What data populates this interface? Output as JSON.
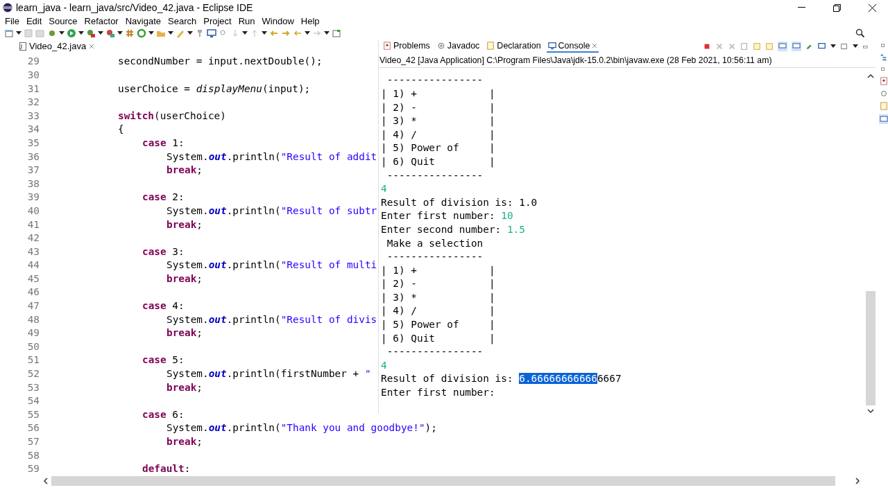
{
  "window": {
    "title": "learn_java - learn_java/src/Video_42.java - Eclipse IDE"
  },
  "menu": [
    "File",
    "Edit",
    "Source",
    "Refactor",
    "Navigate",
    "Search",
    "Project",
    "Run",
    "Window",
    "Help"
  ],
  "editor": {
    "tab": {
      "label": "Video_42.java",
      "selected": true
    },
    "lines": [
      {
        "number": "29",
        "kind": "block",
        "tokens": [
          {
            "text": "secondNumber = input.nextDouble();",
            "kind": "plain"
          }
        ]
      },
      {
        "number": "30",
        "kind": "blank"
      },
      {
        "number": "31",
        "kind": "block",
        "tokens": [
          {
            "text": "userChoice = ",
            "kind": "plain"
          },
          {
            "text": "displayMenu",
            "kind": "method"
          },
          {
            "text": "(input);",
            "kind": "plain"
          }
        ]
      },
      {
        "number": "32",
        "kind": "blank"
      },
      {
        "number": "33",
        "kind": "block",
        "tokens": [
          {
            "text": "switch",
            "kind": "keyword"
          },
          {
            "text": "(userChoice)",
            "kind": "plain"
          }
        ]
      },
      {
        "number": "34",
        "kind": "block",
        "tokens": [
          {
            "text": "{",
            "kind": "plain"
          }
        ]
      },
      {
        "number": "35",
        "kind": "case",
        "tokens": [
          {
            "text": "case",
            "kind": "keyword"
          },
          {
            "text": " 1:",
            "kind": "plain"
          }
        ]
      },
      {
        "number": "36",
        "kind": "body",
        "tokens": [
          {
            "text": "System.",
            "kind": "plain"
          },
          {
            "text": "out",
            "kind": "field"
          },
          {
            "text": ".println(",
            "kind": "plain"
          },
          {
            "text": "\"Result of addit",
            "kind": "string"
          }
        ]
      },
      {
        "number": "37",
        "kind": "body",
        "tokens": [
          {
            "text": "break",
            "kind": "keyword"
          },
          {
            "text": ";",
            "kind": "plain"
          }
        ]
      },
      {
        "number": "38",
        "kind": "blank"
      },
      {
        "number": "39",
        "kind": "case",
        "tokens": [
          {
            "text": "case",
            "kind": "keyword"
          },
          {
            "text": " 2:",
            "kind": "plain"
          }
        ]
      },
      {
        "number": "40",
        "kind": "body",
        "tokens": [
          {
            "text": "System.",
            "kind": "plain"
          },
          {
            "text": "out",
            "kind": "field"
          },
          {
            "text": ".println(",
            "kind": "plain"
          },
          {
            "text": "\"Result of subtr",
            "kind": "string"
          }
        ]
      },
      {
        "number": "41",
        "kind": "body",
        "tokens": [
          {
            "text": "break",
            "kind": "keyword"
          },
          {
            "text": ";",
            "kind": "plain"
          }
        ]
      },
      {
        "number": "42",
        "kind": "blank"
      },
      {
        "number": "43",
        "kind": "case",
        "tokens": [
          {
            "text": "case",
            "kind": "keyword"
          },
          {
            "text": " 3:",
            "kind": "plain"
          }
        ]
      },
      {
        "number": "44",
        "kind": "body",
        "tokens": [
          {
            "text": "System.",
            "kind": "plain"
          },
          {
            "text": "out",
            "kind": "field"
          },
          {
            "text": ".println(",
            "kind": "plain"
          },
          {
            "text": "\"Result of multi",
            "kind": "string"
          }
        ]
      },
      {
        "number": "45",
        "kind": "body",
        "tokens": [
          {
            "text": "break",
            "kind": "keyword"
          },
          {
            "text": ";",
            "kind": "plain"
          }
        ]
      },
      {
        "number": "46",
        "kind": "blank"
      },
      {
        "number": "47",
        "kind": "case",
        "tokens": [
          {
            "text": "case",
            "kind": "keyword"
          },
          {
            "text": " 4:",
            "kind": "plain"
          }
        ]
      },
      {
        "number": "48",
        "kind": "body",
        "tokens": [
          {
            "text": "System.",
            "kind": "plain"
          },
          {
            "text": "out",
            "kind": "field"
          },
          {
            "text": ".println(",
            "kind": "plain"
          },
          {
            "text": "\"Result of divis",
            "kind": "string"
          }
        ]
      },
      {
        "number": "49",
        "kind": "body",
        "tokens": [
          {
            "text": "break",
            "kind": "keyword"
          },
          {
            "text": ";",
            "kind": "plain"
          }
        ]
      },
      {
        "number": "50",
        "kind": "blank"
      },
      {
        "number": "51",
        "kind": "case",
        "tokens": [
          {
            "text": "case",
            "kind": "keyword"
          },
          {
            "text": " 5:",
            "kind": "plain"
          }
        ]
      },
      {
        "number": "52",
        "kind": "body",
        "tokens": [
          {
            "text": "System.",
            "kind": "plain"
          },
          {
            "text": "out",
            "kind": "field"
          },
          {
            "text": ".println(firstNumber + ",
            "kind": "plain"
          },
          {
            "text": "\"",
            "kind": "string"
          }
        ]
      },
      {
        "number": "53",
        "kind": "body",
        "tokens": [
          {
            "text": "break",
            "kind": "keyword"
          },
          {
            "text": ";",
            "kind": "plain"
          }
        ]
      },
      {
        "number": "54",
        "kind": "blank"
      },
      {
        "number": "55",
        "kind": "case",
        "tokens": [
          {
            "text": "case",
            "kind": "keyword"
          },
          {
            "text": " 6:",
            "kind": "plain"
          }
        ]
      },
      {
        "number": "56",
        "kind": "body",
        "tokens": [
          {
            "text": "System.",
            "kind": "plain"
          },
          {
            "text": "out",
            "kind": "field"
          },
          {
            "text": ".println(",
            "kind": "plain"
          },
          {
            "text": "\"Thank you and goodbye!\"",
            "kind": "string"
          },
          {
            "text": ");",
            "kind": "plain"
          }
        ]
      },
      {
        "number": "57",
        "kind": "body",
        "tokens": [
          {
            "text": "break",
            "kind": "keyword"
          },
          {
            "text": ";",
            "kind": "plain"
          }
        ]
      },
      {
        "number": "58",
        "kind": "blank"
      },
      {
        "number": "59",
        "kind": "case",
        "tokens": [
          {
            "text": "default",
            "kind": "keyword"
          },
          {
            "text": ":",
            "kind": "plain"
          }
        ]
      }
    ]
  },
  "console": {
    "tabs": [
      {
        "label": "Problems",
        "selected": false
      },
      {
        "label": "Javadoc",
        "selected": false
      },
      {
        "label": "Declaration",
        "selected": false
      },
      {
        "label": "Console",
        "selected": true
      }
    ],
    "header": "Video_42 [Java Application] C:\\Program Files\\Java\\jdk-15.0.2\\bin\\javaw.exe  (28 Feb 2021, 10:56:11 am)",
    "lines": [
      [
        {
          "text": " ----------------",
          "kind": "output"
        }
      ],
      [
        {
          "text": "| 1) +            |",
          "kind": "output"
        }
      ],
      [
        {
          "text": "| 2) -            |",
          "kind": "output"
        }
      ],
      [
        {
          "text": "| 3) *            |",
          "kind": "output"
        }
      ],
      [
        {
          "text": "| 4) /            |",
          "kind": "output"
        }
      ],
      [
        {
          "text": "| 5) Power of     |",
          "kind": "output"
        }
      ],
      [
        {
          "text": "| 6) Quit         |",
          "kind": "output"
        }
      ],
      [
        {
          "text": " ----------------",
          "kind": "output"
        }
      ],
      [
        {
          "text": "4",
          "kind": "input"
        }
      ],
      [
        {
          "text": "Result of division is: 1.0",
          "kind": "output"
        }
      ],
      [
        {
          "text": "Enter first number: ",
          "kind": "output"
        },
        {
          "text": "10",
          "kind": "input"
        }
      ],
      [
        {
          "text": "Enter second number: ",
          "kind": "output"
        },
        {
          "text": "1.5",
          "kind": "input"
        }
      ],
      [
        {
          "text": " Make a selection",
          "kind": "output"
        }
      ],
      [
        {
          "text": " ----------------",
          "kind": "output"
        }
      ],
      [
        {
          "text": "| 1) +            |",
          "kind": "output"
        }
      ],
      [
        {
          "text": "| 2) -            |",
          "kind": "output"
        }
      ],
      [
        {
          "text": "| 3) *            |",
          "kind": "output"
        }
      ],
      [
        {
          "text": "| 4) /            |",
          "kind": "output"
        }
      ],
      [
        {
          "text": "| 5) Power of     |",
          "kind": "output"
        }
      ],
      [
        {
          "text": "| 6) Quit         |",
          "kind": "output"
        }
      ],
      [
        {
          "text": " ----------------",
          "kind": "output"
        }
      ],
      [
        {
          "text": "4",
          "kind": "input"
        }
      ],
      [
        {
          "text": "Result of division is: ",
          "kind": "output"
        },
        {
          "text": "6.66666666666",
          "kind": "selected"
        },
        {
          "text": "6667",
          "kind": "output"
        }
      ],
      [
        {
          "text": "Enter first number: ",
          "kind": "output"
        }
      ]
    ]
  }
}
